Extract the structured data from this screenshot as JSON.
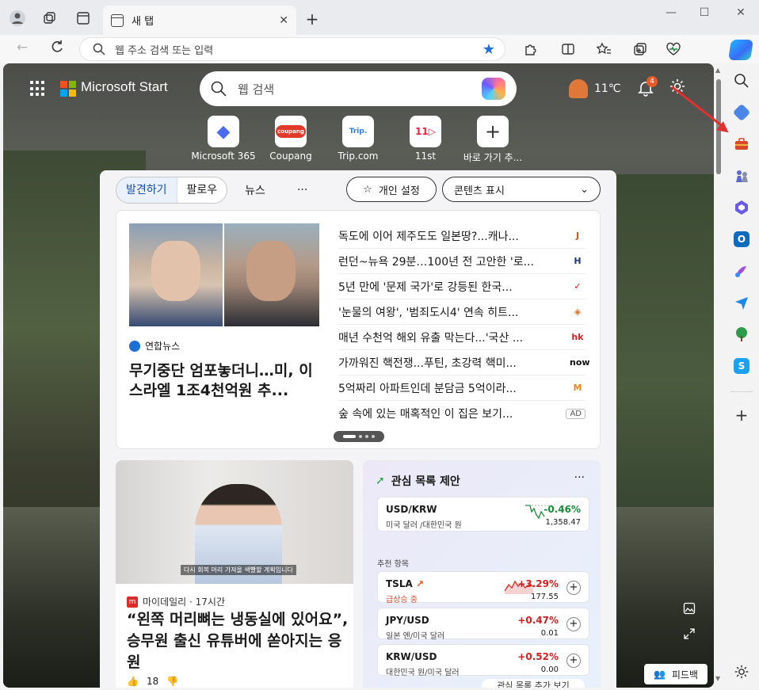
{
  "browser": {
    "tab_title": "새 탭",
    "address_placeholder": "웹 주소 검색 또는 입력",
    "new_tab_symbol": "+",
    "close_symbol": "✕"
  },
  "start": {
    "brand": "Microsoft Start",
    "search_placeholder": "웹 검색",
    "weather_temp": "11℃",
    "notification_count": "4",
    "brand_colors": [
      "#f25022",
      "#7fba00",
      "#00a4ef",
      "#ffb900"
    ]
  },
  "quick_links": [
    {
      "label": "Microsoft 365",
      "icon": "microsoft-365-icon",
      "glyph": "◆"
    },
    {
      "label": "Coupang",
      "icon": "coupang-icon",
      "glyph": "coupang"
    },
    {
      "label": "Trip.com",
      "icon": "trip-icon",
      "glyph": "Trip."
    },
    {
      "label": "11st",
      "icon": "11st-icon",
      "glyph": "11▷"
    },
    {
      "label": "바로 가기 추...",
      "icon": "add-shortcut-icon",
      "glyph": "+"
    }
  ],
  "feed_tabs": {
    "discover": "발견하기",
    "following": "팔로우",
    "news": "뉴스",
    "more": "···",
    "personalize": "개인 설정",
    "content_display": "콘텐츠 표시"
  },
  "top_story": {
    "source": "연합뉴스",
    "headline": "무기중단 엄포놓더니…미, 이스라엘 1조4천억원 추..."
  },
  "headlines": [
    {
      "text": "독도에 이어 제주도도 일본땅?...캐나...",
      "src": "J",
      "color": "#d5541f"
    },
    {
      "text": "런던~뉴욕 29분…100년 전 고안한 '로...",
      "src": "H",
      "color": "#1f3a7a"
    },
    {
      "text": "5년 만에 '문제 국가'로 강등된 한국...",
      "src": "✓",
      "color": "#d02020"
    },
    {
      "text": "'눈물의 여왕', '범죄도시4' 연속 히트...",
      "src": "◈",
      "color": "#e07020"
    },
    {
      "text": "매년 수천억 해외 유출 막는다...'국산 ...",
      "src": "hk",
      "color": "#d02020"
    },
    {
      "text": "가까워진 핵전쟁...푸틴, 초강력 핵미...",
      "src": "now",
      "color": "#111111"
    },
    {
      "text": "5억짜리 아파트인데 분담금 5억이라...",
      "src": "M",
      "color": "#e88a1a"
    },
    {
      "text": "숲 속에 있는 매혹적인 이 집은 보기...",
      "src": "AD",
      "color": "#555555"
    }
  ],
  "video_card": {
    "source": "마이데일리",
    "time": "· 17시간",
    "caption": "다시 회복 머리 가져올 색빨할 계획입니다",
    "title": "“왼쪽 머리뼈는 냉동실에 있어요”, 승무원 출신 유튜버에 쏟아지는 응원",
    "likes": "18"
  },
  "watchlist": {
    "title": "관심 목록 제안",
    "more": "···",
    "recommended": "추천 항목",
    "footer": "관심 목록 추가 보기",
    "items": [
      {
        "name": "USD/KRW",
        "sub": "미국 달러 /대한민국 원",
        "change": "-0.46%",
        "price": "1,358.47",
        "color": "#1a8a3a"
      },
      {
        "name": "TSLA",
        "sub": "급상승 중",
        "change": "+3.29%",
        "price": "177.55",
        "color": "#d02020"
      },
      {
        "name": "JPY/USD",
        "sub": "일본 엔/미국 달러",
        "change": "+0.47%",
        "price": "0.01",
        "color": "#d02020"
      },
      {
        "name": "KRW/USD",
        "sub": "대한민국 원/미국 달러",
        "change": "+0.52%",
        "price": "0.00",
        "color": "#d02020"
      }
    ]
  },
  "feedback_label": "피드백",
  "accent": "#1f6fd6"
}
